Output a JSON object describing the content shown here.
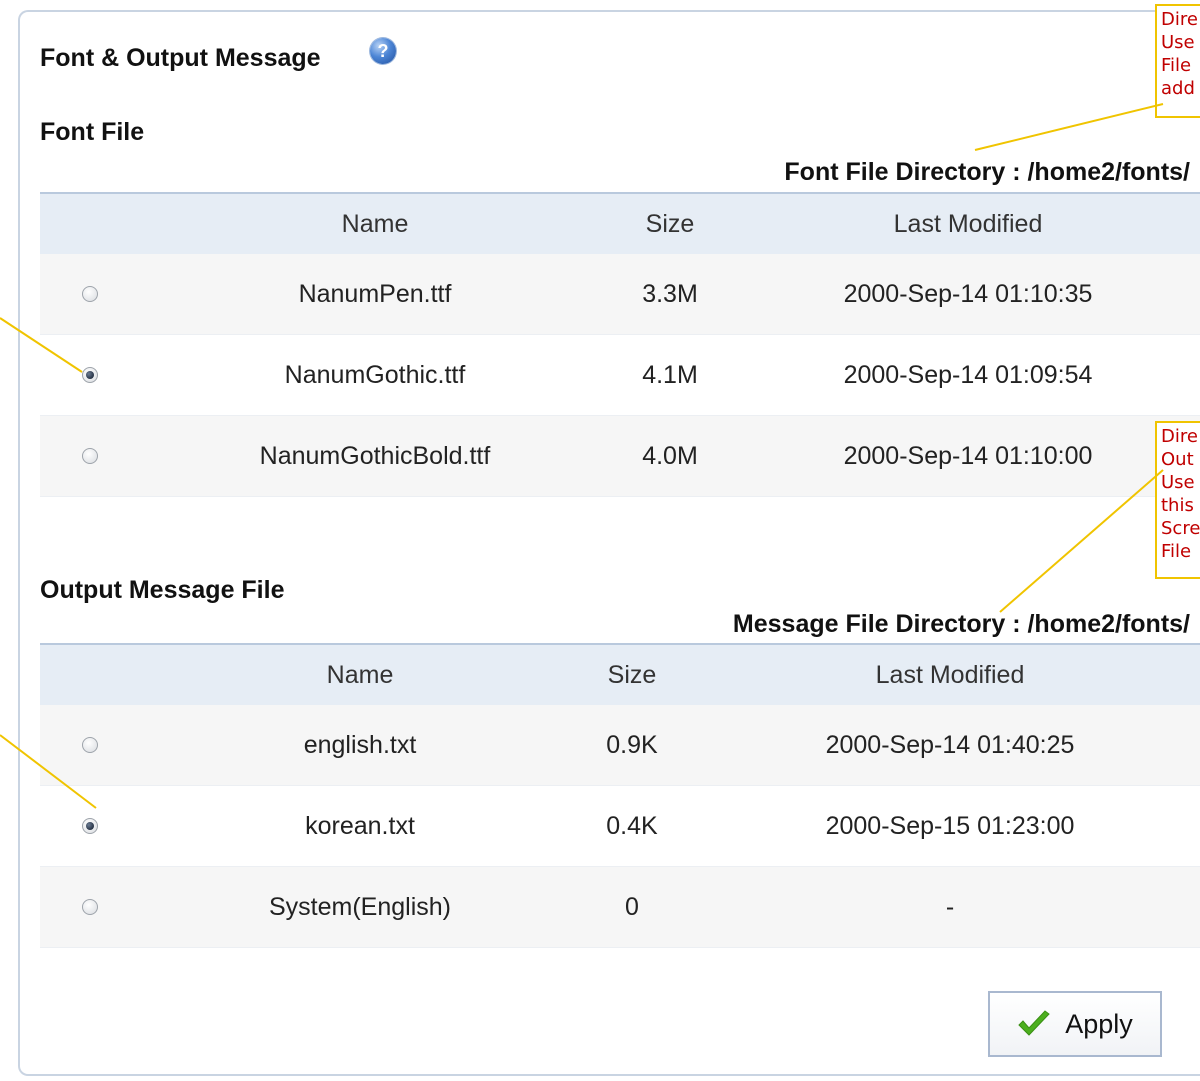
{
  "page": {
    "title": "Font & Output Message",
    "help_icon": "question-mark-icon"
  },
  "font_section": {
    "title": "Font File",
    "directory_label": "Font File Directory : /home2/fonts/",
    "columns": [
      "Name",
      "Size",
      "Last Modified"
    ],
    "rows": [
      {
        "name": "NanumPen.ttf",
        "size": "3.3M",
        "modified": "2000-Sep-14 01:10:35",
        "selected": false
      },
      {
        "name": "NanumGothic.ttf",
        "size": "4.1M",
        "modified": "2000-Sep-14 01:09:54",
        "selected": true
      },
      {
        "name": "NanumGothicBold.ttf",
        "size": "4.0M",
        "modified": "2000-Sep-14 01:10:00",
        "selected": false
      }
    ]
  },
  "message_section": {
    "title": "Output Message File",
    "directory_label": "Message File Directory : /home2/fonts/",
    "columns": [
      "Name",
      "Size",
      "Last Modified"
    ],
    "rows": [
      {
        "name": "english.txt",
        "size": "0.9K",
        "modified": "2000-Sep-14 01:40:25",
        "selected": false
      },
      {
        "name": "korean.txt",
        "size": "0.4K",
        "modified": "2000-Sep-15 01:23:00",
        "selected": true
      },
      {
        "name": "System(English)",
        "size": "0",
        "modified": "-",
        "selected": false
      }
    ]
  },
  "apply_button": {
    "label": "Apply",
    "icon": "checkmark-icon"
  },
  "callouts": {
    "font_directory": [
      "Dire",
      "Use",
      "File",
      "add"
    ],
    "message_directory": [
      "Dire",
      "Out",
      "Use",
      "this",
      "Scre",
      "File"
    ]
  },
  "colors": {
    "header_bg": "#e6edf5",
    "callout_border": "#f0c400",
    "callout_text": "#c00000",
    "check_green": "#4caf1e"
  }
}
